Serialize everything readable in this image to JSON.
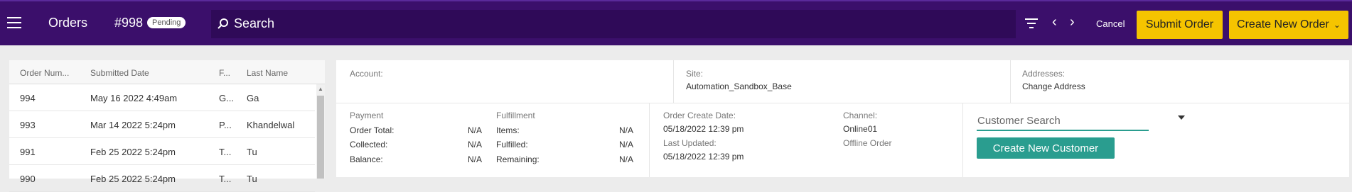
{
  "header": {
    "title": "Orders",
    "order_number": "#998",
    "status_badge": "Pending",
    "search_placeholder": "Search",
    "cancel_label": "Cancel",
    "submit_label": "Submit Order",
    "create_label": "Create New Order",
    "accent_color": "#f5c400",
    "bar_color": "#3b0f6b"
  },
  "orders_list": {
    "columns": [
      "Order Num...",
      "Submitted Date",
      "F...",
      "Last Name"
    ],
    "rows": [
      {
        "order": "994",
        "date": "May 16 2022 4:49am",
        "first": "G...",
        "last": "Ga"
      },
      {
        "order": "993",
        "date": "Mar 14 2022 5:24pm",
        "first": "P...",
        "last": "Khandelwal"
      },
      {
        "order": "991",
        "date": "Feb 25 2022 5:24pm",
        "first": "T...",
        "last": "Tu"
      },
      {
        "order": "990",
        "date": "Feb 25 2022 5:24pm",
        "first": "T...",
        "last": "Tu"
      }
    ]
  },
  "details": {
    "account_label": "Account:",
    "site_label": "Site:",
    "site_value": "Automation_Sandbox_Base",
    "addresses_label": "Addresses:",
    "addresses_value": "Change Address",
    "payment": {
      "title": "Payment",
      "order_total_label": "Order Total:",
      "order_total_value": "N/A",
      "collected_label": "Collected:",
      "collected_value": "N/A",
      "balance_label": "Balance:",
      "balance_value": "N/A"
    },
    "fulfillment": {
      "title": "Fulfillment",
      "items_label": "Items:",
      "items_value": "N/A",
      "fulfilled_label": "Fulfilled:",
      "fulfilled_value": "N/A",
      "remaining_label": "Remaining:",
      "remaining_value": "N/A"
    },
    "order_create_label": "Order Create Date:",
    "order_create_value": "05/18/2022 12:39 pm",
    "last_updated_label": "Last Updated:",
    "last_updated_value": "05/18/2022 12:39 pm",
    "channel_label": "Channel:",
    "channel_value": "Online01",
    "offline_order": "Offline Order",
    "customer_search_placeholder": "Customer Search",
    "create_customer_label": "Create New Customer",
    "teal_color": "#2a9d8f"
  }
}
